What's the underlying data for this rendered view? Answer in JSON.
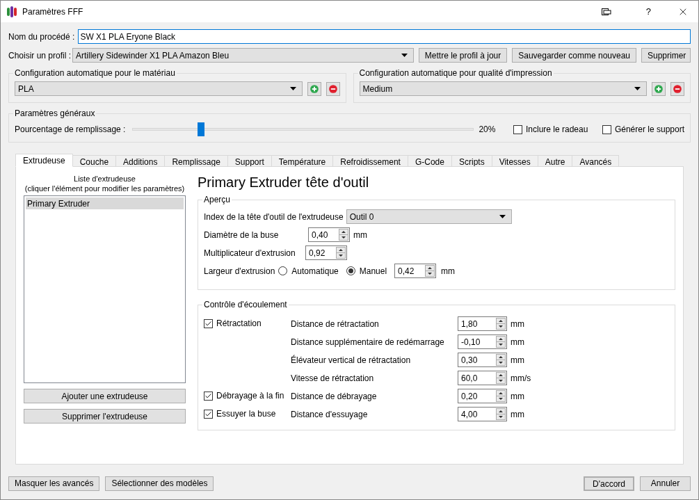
{
  "window": {
    "title": "Paramètres FFF",
    "help": "?"
  },
  "process_name": {
    "label": "Nom du procédé :",
    "value": "SW X1 PLA Eryone Black"
  },
  "profile": {
    "label": "Choisir un profil :",
    "value": "Artillery Sidewinder X1 PLA Amazon Bleu",
    "buttons": [
      "Mettre le profil à jour",
      "Sauvegarder comme nouveau",
      "Supprimer"
    ]
  },
  "auto_config": [
    {
      "title": "Configuration automatique pour le matériau",
      "value": "PLA"
    },
    {
      "title": "Configuration automatique pour qualité d'impression",
      "value": "Medium"
    }
  ],
  "general": {
    "title": "Paramètres généraux",
    "infill_label": "Pourcentage de remplissage :",
    "level": 0.2,
    "reading": "20%",
    "options": [
      {
        "label": "Inclure le radeau",
        "checked": false
      },
      {
        "label": "Générer le support",
        "checked": false
      }
    ]
  },
  "tabs": [
    {
      "label": "Extrudeuse",
      "selected": true
    },
    {
      "label": "Couche",
      "selected": false
    },
    {
      "label": "Additions",
      "selected": false
    },
    {
      "label": "Remplissage",
      "selected": false
    },
    {
      "label": "Support",
      "selected": false
    },
    {
      "label": "Température",
      "selected": false
    },
    {
      "label": "Refroidissement",
      "selected": false
    },
    {
      "label": "G-Code",
      "selected": false
    },
    {
      "label": "Scripts",
      "selected": false
    },
    {
      "label": "Vitesses",
      "selected": false
    },
    {
      "label": "Autre",
      "selected": false
    },
    {
      "label": "Avancés",
      "selected": false
    }
  ],
  "extruder_list": {
    "caption": [
      "Liste d'extrudeuse",
      "(cliquer l'élément pour modifier les paramètres)"
    ],
    "items": [
      {
        "label": "Primary Extruder",
        "selected": true
      }
    ],
    "buttons": [
      "Ajouter une extrudeuse",
      "Supprimer l'extrudeuse"
    ]
  },
  "extruder": {
    "heading": "Primary Extruder tête d'outil",
    "overview": {
      "title": "Aperçu",
      "tool_index": {
        "label": "Index de la tête d'outil de l'extrudeuse",
        "value": "Outil 0"
      },
      "nozzle": {
        "label": "Diamètre de la buse",
        "value": "0,40",
        "unit": "mm"
      },
      "multiplier": {
        "label": "Multiplicateur d'extrusion",
        "value": "0,92"
      },
      "width": {
        "label": "Largeur d'extrusion",
        "options": [
          {
            "label": "Automatique",
            "selected": false
          },
          {
            "label": "Manuel",
            "selected": true
          }
        ],
        "value": "0,42",
        "unit": "mm"
      }
    },
    "flow": {
      "title": "Contrôle d'écoulement",
      "rows": [
        {
          "checkbox": {
            "label": "Rétractation",
            "checked": true
          },
          "label": "Distance de rétractation",
          "value": "1,80",
          "unit": "mm"
        },
        {
          "label": "Distance supplémentaire de redémarrage",
          "value": "-0,10",
          "unit": "mm"
        },
        {
          "label": "Élévateur vertical de rétractation",
          "value": "0,30",
          "unit": "mm"
        },
        {
          "label": "Vitesse de rétractation",
          "value": "60,0",
          "unit": "mm/s"
        },
        {
          "checkbox": {
            "label": "Débrayage à la fin",
            "checked": true
          },
          "label": "Distance de débrayage",
          "value": "0,20",
          "unit": "mm"
        },
        {
          "checkbox": {
            "label": "Essuyer la buse",
            "checked": true
          },
          "label": "Distance d'essuyage",
          "value": "4,00",
          "unit": "mm"
        }
      ]
    }
  },
  "footer": {
    "left": [
      "Masquer les avancés",
      "Sélectionner des modèles"
    ],
    "ok": "D'accord",
    "cancel": "Annuler"
  }
}
